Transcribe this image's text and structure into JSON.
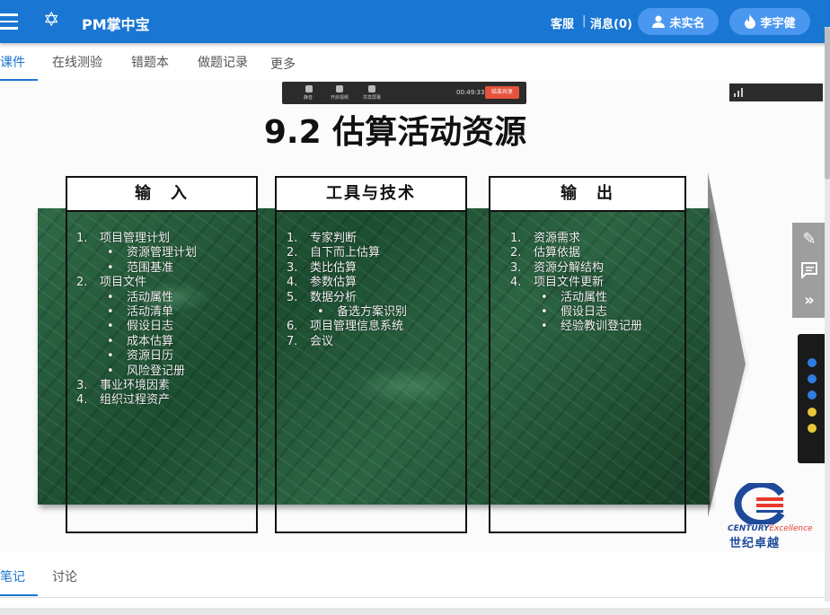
{
  "header": {
    "app_title": "PM掌中宝",
    "links": {
      "service": "客服",
      "separator": "|",
      "messages": "消息(0)"
    },
    "pills": {
      "unverified": "未实名",
      "user": "李宇健"
    },
    "icons": {
      "menu": "menu-icon",
      "logo": "star-of-david-icon",
      "person": "person-icon",
      "flame": "flame-icon"
    }
  },
  "tabs": [
    "课件",
    "在线测验",
    "错题本",
    "做题记录",
    "更多"
  ],
  "slide": {
    "title": "9.2 估算活动资源",
    "meeting_bar": {
      "time": "00:49:33",
      "end_label": "结束共享",
      "items": [
        "静音",
        "开启视频",
        "共享屏幕"
      ]
    },
    "columns": [
      {
        "heading": "输　入",
        "items": [
          {
            "num": "1.",
            "text": "项目管理计划",
            "sub": [
              "资源管理计划",
              "范围基准"
            ]
          },
          {
            "num": "2.",
            "text": "项目文件",
            "sub": [
              "活动属性",
              "活动清单",
              "假设日志",
              "成本估算",
              "资源日历",
              "风险登记册"
            ]
          },
          {
            "num": "3.",
            "text": "事业环境因素",
            "sub": []
          },
          {
            "num": "4.",
            "text": "组织过程资产",
            "sub": []
          }
        ]
      },
      {
        "heading": "工具与技术",
        "items": [
          {
            "num": "1.",
            "text": "专家判断",
            "sub": []
          },
          {
            "num": "2.",
            "text": "自下而上估算",
            "sub": []
          },
          {
            "num": "3.",
            "text": "类比估算",
            "sub": []
          },
          {
            "num": "4.",
            "text": "参数估算",
            "sub": []
          },
          {
            "num": "5.",
            "text": "数据分析",
            "sub": [
              "备选方案识别"
            ]
          },
          {
            "num": "6.",
            "text": "项目管理信息系统",
            "sub": []
          },
          {
            "num": "7.",
            "text": "会议",
            "sub": []
          }
        ]
      },
      {
        "heading": "输　出",
        "items": [
          {
            "num": "1.",
            "text": "资源需求",
            "sub": []
          },
          {
            "num": "2.",
            "text": "估算依据",
            "sub": []
          },
          {
            "num": "3.",
            "text": "资源分解结构",
            "sub": []
          },
          {
            "num": "4.",
            "text": "项目文件更新",
            "sub": [
              "活动属性",
              "假设日志",
              "经验教训登记册"
            ]
          }
        ]
      }
    ],
    "logo": {
      "en_a": "CENTURY",
      "en_b": "Excellence",
      "cn": "世纪卓越"
    }
  },
  "float_panel": {
    "icons": [
      "pencil-icon",
      "comment-icon",
      "double-chevron-right-icon"
    ]
  },
  "bottom_tabs": [
    "笔记",
    "讨论"
  ],
  "colors": {
    "primary": "#1976d2",
    "pill": "#4a97f0",
    "slide_green": "#1f5233"
  }
}
